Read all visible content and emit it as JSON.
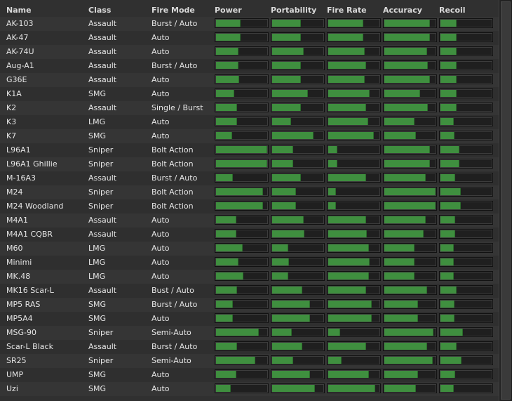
{
  "columns": {
    "name": "Name",
    "class": "Class",
    "fire_mode": "Fire Mode",
    "power": "Power",
    "portability": "Portability",
    "fire_rate": "Fire Rate",
    "accuracy": "Accuracy",
    "recoil": "Recoil"
  },
  "bar_color": "#3f8f3f",
  "weapons": [
    {
      "name": "AK-103",
      "class": "Assault",
      "fire_mode": "Burst / Auto",
      "power": 0.47,
      "portability": 0.55,
      "fire_rate": 0.67,
      "accuracy": 0.88,
      "recoil": 0.3
    },
    {
      "name": "AK-47",
      "class": "Assault",
      "fire_mode": "Auto",
      "power": 0.47,
      "portability": 0.55,
      "fire_rate": 0.67,
      "accuracy": 0.88,
      "recoil": 0.3
    },
    {
      "name": "AK-74U",
      "class": "Assault",
      "fire_mode": "Auto",
      "power": 0.42,
      "portability": 0.6,
      "fire_rate": 0.7,
      "accuracy": 0.82,
      "recoil": 0.3
    },
    {
      "name": "Aug-A1",
      "class": "Assault",
      "fire_mode": "Burst / Auto",
      "power": 0.42,
      "portability": 0.55,
      "fire_rate": 0.72,
      "accuracy": 0.84,
      "recoil": 0.3
    },
    {
      "name": "G36E",
      "class": "Assault",
      "fire_mode": "Auto",
      "power": 0.44,
      "portability": 0.55,
      "fire_rate": 0.7,
      "accuracy": 0.87,
      "recoil": 0.3
    },
    {
      "name": "K1A",
      "class": "SMG",
      "fire_mode": "Auto",
      "power": 0.34,
      "portability": 0.68,
      "fire_rate": 0.8,
      "accuracy": 0.69,
      "recoil": 0.3
    },
    {
      "name": "K2",
      "class": "Assault",
      "fire_mode": "Single / Burst",
      "power": 0.4,
      "portability": 0.55,
      "fire_rate": 0.72,
      "accuracy": 0.84,
      "recoil": 0.3
    },
    {
      "name": "K3",
      "class": "LMG",
      "fire_mode": "Auto",
      "power": 0.4,
      "portability": 0.35,
      "fire_rate": 0.77,
      "accuracy": 0.57,
      "recoil": 0.24
    },
    {
      "name": "K7",
      "class": "SMG",
      "fire_mode": "Auto",
      "power": 0.3,
      "portability": 0.8,
      "fire_rate": 0.87,
      "accuracy": 0.6,
      "recoil": 0.26
    },
    {
      "name": "L96A1",
      "class": "Sniper",
      "fire_mode": "Bolt Action",
      "power": 0.98,
      "portability": 0.4,
      "fire_rate": 0.16,
      "accuracy": 0.88,
      "recoil": 0.36
    },
    {
      "name": "L96A1 Ghillie",
      "class": "Sniper",
      "fire_mode": "Bolt Action",
      "power": 0.98,
      "portability": 0.4,
      "fire_rate": 0.16,
      "accuracy": 0.88,
      "recoil": 0.36
    },
    {
      "name": "M-16A3",
      "class": "Assault",
      "fire_mode": "Burst / Auto",
      "power": 0.32,
      "portability": 0.55,
      "fire_rate": 0.72,
      "accuracy": 0.8,
      "recoil": 0.28
    },
    {
      "name": "M24",
      "class": "Sniper",
      "fire_mode": "Bolt Action",
      "power": 0.9,
      "portability": 0.45,
      "fire_rate": 0.14,
      "accuracy": 0.98,
      "recoil": 0.39
    },
    {
      "name": "M24 Woodland",
      "class": "Sniper",
      "fire_mode": "Bolt Action",
      "power": 0.9,
      "portability": 0.45,
      "fire_rate": 0.14,
      "accuracy": 0.98,
      "recoil": 0.39
    },
    {
      "name": "M4A1",
      "class": "Assault",
      "fire_mode": "Auto",
      "power": 0.38,
      "portability": 0.6,
      "fire_rate": 0.72,
      "accuracy": 0.8,
      "recoil": 0.28
    },
    {
      "name": "M4A1 CQBR",
      "class": "Assault",
      "fire_mode": "Auto",
      "power": 0.38,
      "portability": 0.62,
      "fire_rate": 0.74,
      "accuracy": 0.76,
      "recoil": 0.28
    },
    {
      "name": "M60",
      "class": "LMG",
      "fire_mode": "Auto",
      "power": 0.5,
      "portability": 0.3,
      "fire_rate": 0.78,
      "accuracy": 0.57,
      "recoil": 0.25
    },
    {
      "name": "Minimi",
      "class": "LMG",
      "fire_mode": "Auto",
      "power": 0.42,
      "portability": 0.32,
      "fire_rate": 0.8,
      "accuracy": 0.57,
      "recoil": 0.25
    },
    {
      "name": "MK.48",
      "class": "LMG",
      "fire_mode": "Auto",
      "power": 0.52,
      "portability": 0.3,
      "fire_rate": 0.78,
      "accuracy": 0.57,
      "recoil": 0.25
    },
    {
      "name": "MK16 Scar-L",
      "class": "Assault",
      "fire_mode": "Bust / Auto",
      "power": 0.4,
      "portability": 0.58,
      "fire_rate": 0.72,
      "accuracy": 0.82,
      "recoil": 0.3
    },
    {
      "name": "MP5 RAS",
      "class": "SMG",
      "fire_mode": "Burst / Auto",
      "power": 0.32,
      "portability": 0.72,
      "fire_rate": 0.83,
      "accuracy": 0.65,
      "recoil": 0.26
    },
    {
      "name": "MP5A4",
      "class": "SMG",
      "fire_mode": "Auto",
      "power": 0.32,
      "portability": 0.72,
      "fire_rate": 0.83,
      "accuracy": 0.65,
      "recoil": 0.26
    },
    {
      "name": "MSG-90",
      "class": "Sniper",
      "fire_mode": "Semi-Auto",
      "power": 0.82,
      "portability": 0.37,
      "fire_rate": 0.22,
      "accuracy": 0.95,
      "recoil": 0.42
    },
    {
      "name": "Scar-L Black",
      "class": "Assault",
      "fire_mode": "Burst / Auto",
      "power": 0.4,
      "portability": 0.58,
      "fire_rate": 0.72,
      "accuracy": 0.82,
      "recoil": 0.3
    },
    {
      "name": "SR25",
      "class": "Sniper",
      "fire_mode": "Semi-Auto",
      "power": 0.75,
      "portability": 0.4,
      "fire_rate": 0.25,
      "accuracy": 0.93,
      "recoil": 0.4
    },
    {
      "name": "UMP",
      "class": "SMG",
      "fire_mode": "Auto",
      "power": 0.38,
      "portability": 0.72,
      "fire_rate": 0.78,
      "accuracy": 0.65,
      "recoil": 0.27
    },
    {
      "name": "Uzi",
      "class": "SMG",
      "fire_mode": "Auto",
      "power": 0.28,
      "portability": 0.82,
      "fire_rate": 0.9,
      "accuracy": 0.6,
      "recoil": 0.25
    }
  ]
}
